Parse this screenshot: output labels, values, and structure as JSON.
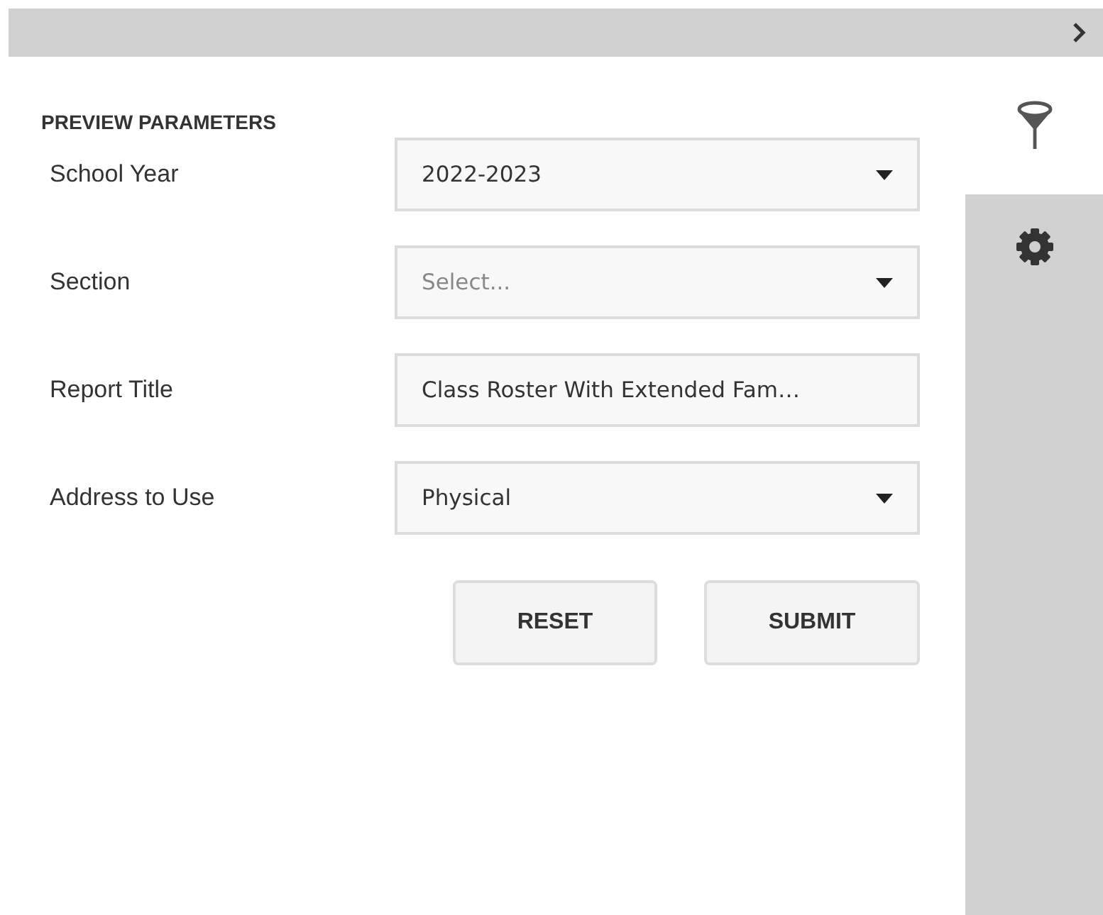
{
  "title": "PREVIEW PARAMETERS",
  "rail_tabs": [
    {
      "kind": "filter",
      "selected": true
    },
    {
      "kind": "settings",
      "selected": false
    }
  ],
  "parameters": [
    {
      "label": "School Year",
      "kind": "select",
      "value": "2022-2023"
    },
    {
      "label": "Section",
      "kind": "select",
      "placeholder": "Select..."
    },
    {
      "label": "Report Title",
      "kind": "text",
      "value": "Class Roster With Extended Fam…"
    },
    {
      "label": "Address to Use",
      "kind": "select",
      "value": "Physical"
    }
  ],
  "buttons": [
    "RESET",
    "SUBMIT"
  ]
}
